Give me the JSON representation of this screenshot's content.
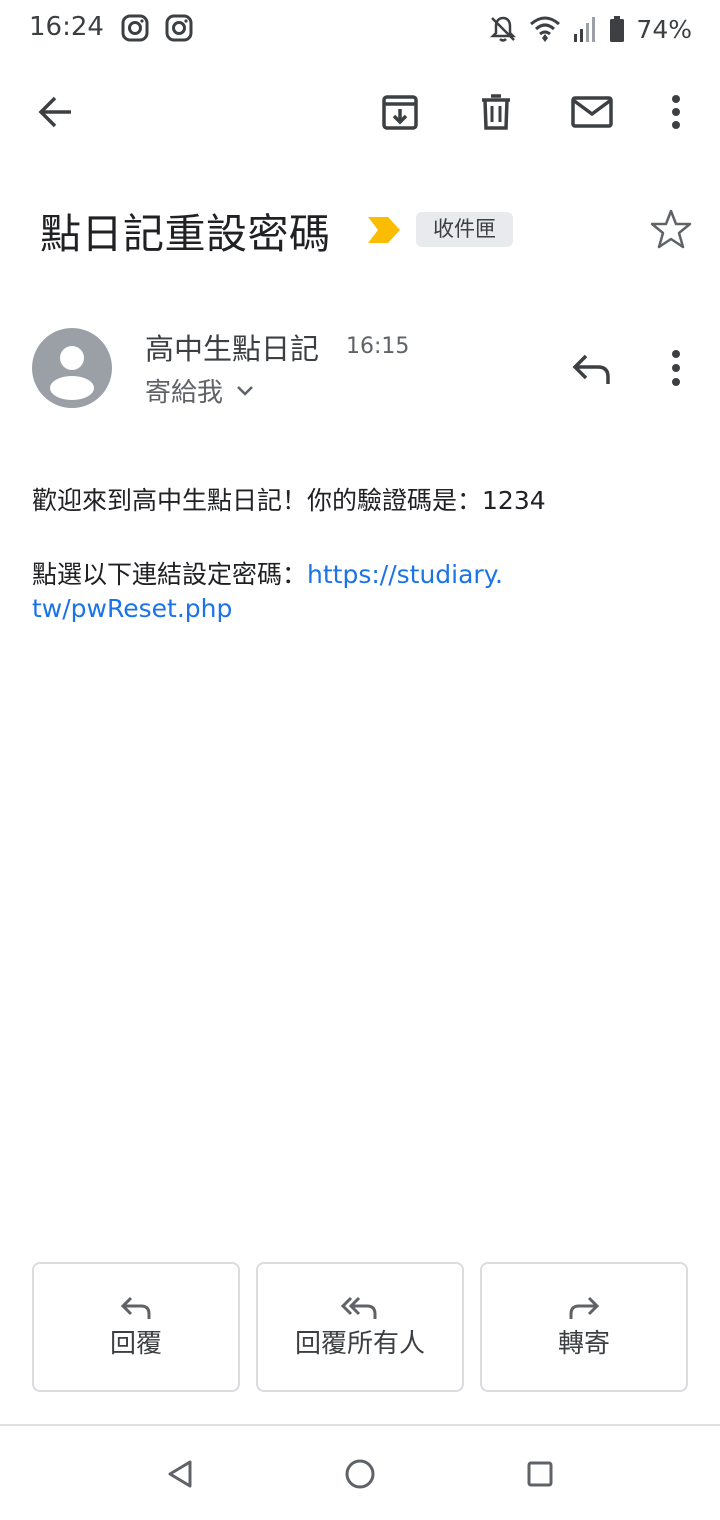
{
  "status_bar": {
    "time": "16:24",
    "battery_percent": "74%",
    "icons": [
      "instagram-icon",
      "instagram-icon",
      "notifications-off-icon",
      "wifi-icon",
      "signal-icon",
      "battery-icon"
    ]
  },
  "toolbar": {
    "icons": [
      "back-arrow-icon",
      "archive-icon",
      "delete-icon",
      "mark-unread-icon",
      "more-vert-icon"
    ]
  },
  "email": {
    "subject": "點日記重設密碼",
    "label": "收件匣",
    "sender_name": "高中生點日記",
    "time": "16:15",
    "to": "寄給我",
    "body_line1": "歡迎來到高中生點日記！你的驗證碼是：1234",
    "body_line2_prefix": "點選以下連結設定密碼：",
    "link_part1": "https://studiary.",
    "link_part2": "tw/pwReset.php"
  },
  "actions": {
    "reply": "回覆",
    "reply_all": "回覆所有人",
    "forward": "轉寄"
  },
  "colors": {
    "accent_link": "#1a73e8",
    "importance": "#fbbc04",
    "chip_bg": "#e8eaed"
  }
}
